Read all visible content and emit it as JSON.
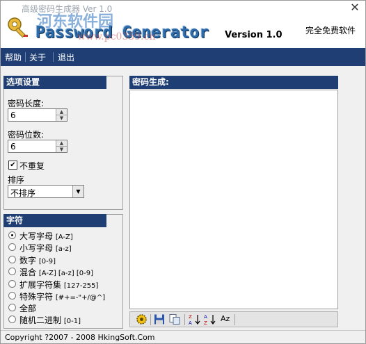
{
  "window": {
    "title": "高级密码生成器 Ver 1.0",
    "close_glyph": "✕"
  },
  "header": {
    "logo_text": "Password Generator",
    "version": "Version 1.0",
    "free_label": "完全免费软件",
    "watermark_cn": "河东软件园",
    "watermark_url": "www.pc0359.cn"
  },
  "menu": {
    "items": [
      "帮助",
      "关于",
      "退出"
    ]
  },
  "options": {
    "title": "选项设置",
    "length_label": "密码长度:",
    "length_value": "6",
    "count_label": "密码位数:",
    "count_value": "6",
    "no_repeat_label": "不重复",
    "no_repeat_checked": true,
    "sort_label": "排序",
    "sort_value": "不排序"
  },
  "chars": {
    "title": "字符",
    "items": [
      {
        "label": "大写字母",
        "range": "[A-Z]",
        "selected": true
      },
      {
        "label": "小写字母",
        "range": "[a-z]",
        "selected": false
      },
      {
        "label": "数字",
        "range": "[0-9]",
        "selected": false
      },
      {
        "label": "混合",
        "range": "[A-Z] [a-z] [0-9]",
        "selected": false
      },
      {
        "label": "扩展字符集",
        "range": "[127-255]",
        "selected": false
      },
      {
        "label": "特殊字符",
        "range": "[#+=-\"+/@^]",
        "selected": false
      },
      {
        "label": "全部",
        "range": "",
        "selected": false
      },
      {
        "label": "随机二进制",
        "range": "[0-1]",
        "selected": false
      }
    ]
  },
  "output": {
    "title": "密码生成:"
  },
  "toolbar": {
    "sort_az_text": "Az",
    "icons": [
      "generate-gear-icon",
      "save-icon",
      "copy-icon",
      "sort-desc-icon",
      "sort-asc-icon",
      "case-icon"
    ]
  },
  "status": {
    "copyright": "Copyright ?2007 - 2008 HkingSoft.Com"
  },
  "colors": {
    "accent": "#1f3e74",
    "logo": "#2d6aa7"
  }
}
